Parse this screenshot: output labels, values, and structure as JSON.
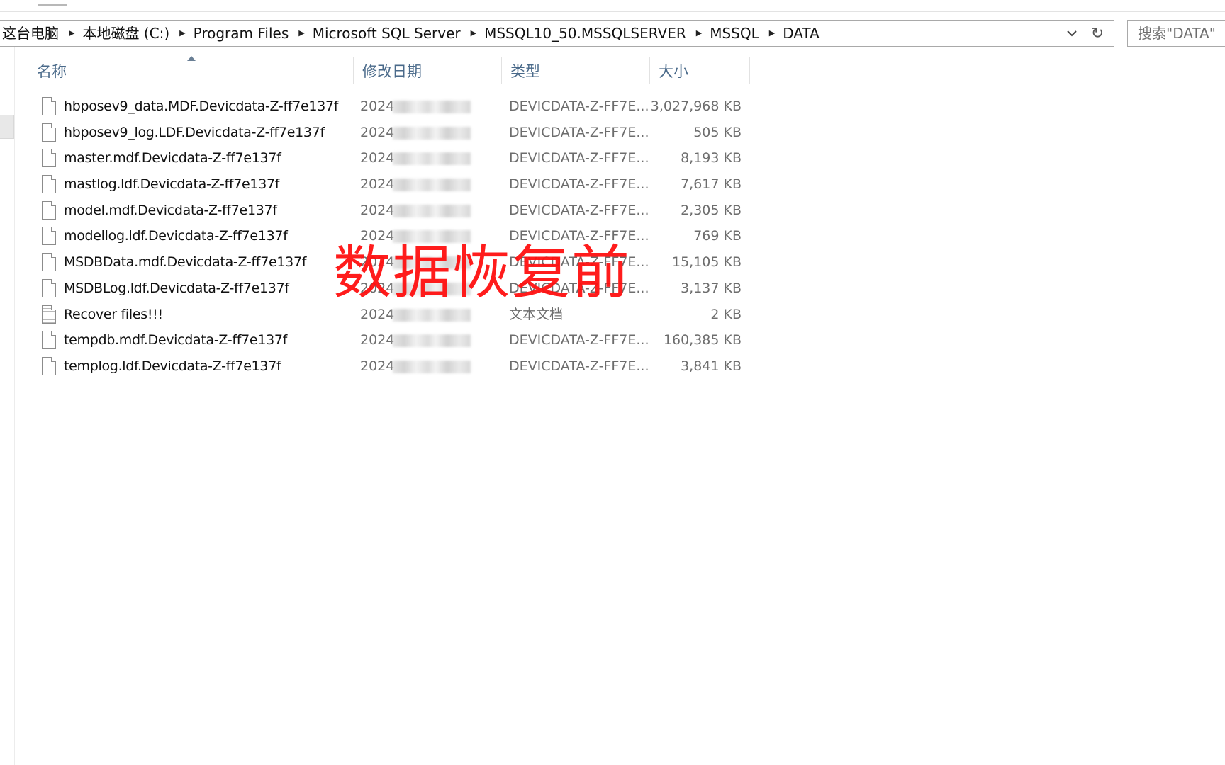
{
  "address": {
    "crumbs": [
      "这台电脑",
      "本地磁盘 (C:)",
      "Program Files",
      "Microsoft SQL Server",
      "MSSQL10_50.MSSQLSERVER",
      "MSSQL",
      "DATA"
    ]
  },
  "search": {
    "placeholder": "搜索\"DATA\""
  },
  "columns": {
    "name": "名称",
    "date": "修改日期",
    "type": "类型",
    "size": "大小"
  },
  "files": [
    {
      "name": "hbposev9_data.MDF.Devicdata-Z-ff7e137f",
      "date": "2024",
      "type": "DEVICDATA-Z-FF7E...",
      "size": "3,027,968 KB",
      "icon": "file-icon"
    },
    {
      "name": "hbposev9_log.LDF.Devicdata-Z-ff7e137f",
      "date": "2024",
      "type": "DEVICDATA-Z-FF7E...",
      "size": "505 KB",
      "icon": "file-icon"
    },
    {
      "name": "master.mdf.Devicdata-Z-ff7e137f",
      "date": "2024",
      "type": "DEVICDATA-Z-FF7E...",
      "size": "8,193 KB",
      "icon": "file-icon"
    },
    {
      "name": "mastlog.ldf.Devicdata-Z-ff7e137f",
      "date": "2024",
      "type": "DEVICDATA-Z-FF7E...",
      "size": "7,617 KB",
      "icon": "file-icon"
    },
    {
      "name": "model.mdf.Devicdata-Z-ff7e137f",
      "date": "2024",
      "type": "DEVICDATA-Z-FF7E...",
      "size": "2,305 KB",
      "icon": "file-icon"
    },
    {
      "name": "modellog.ldf.Devicdata-Z-ff7e137f",
      "date": "2024",
      "type": "DEVICDATA-Z-FF7E...",
      "size": "769 KB",
      "icon": "file-icon"
    },
    {
      "name": "MSDBData.mdf.Devicdata-Z-ff7e137f",
      "date": "2024",
      "type": "DEVICDATA-Z-FF7E...",
      "size": "15,105 KB",
      "icon": "file-icon"
    },
    {
      "name": "MSDBLog.ldf.Devicdata-Z-ff7e137f",
      "date": "2024",
      "type": "DEVICDATA-Z-FF7E...",
      "size": "3,137 KB",
      "icon": "file-icon"
    },
    {
      "name": "Recover files!!!",
      "date": "2024",
      "type": "文本文档",
      "size": "2 KB",
      "icon": "text-file-icon"
    },
    {
      "name": "tempdb.mdf.Devicdata-Z-ff7e137f",
      "date": "2024",
      "type": "DEVICDATA-Z-FF7E...",
      "size": "160,385 KB",
      "icon": "file-icon"
    },
    {
      "name": "templog.ldf.Devicdata-Z-ff7e137f",
      "date": "2024",
      "type": "DEVICDATA-Z-FF7E...",
      "size": "3,841 KB",
      "icon": "file-icon"
    }
  ],
  "watermark": {
    "text": "数据恢复前",
    "color": "#ff1010"
  }
}
